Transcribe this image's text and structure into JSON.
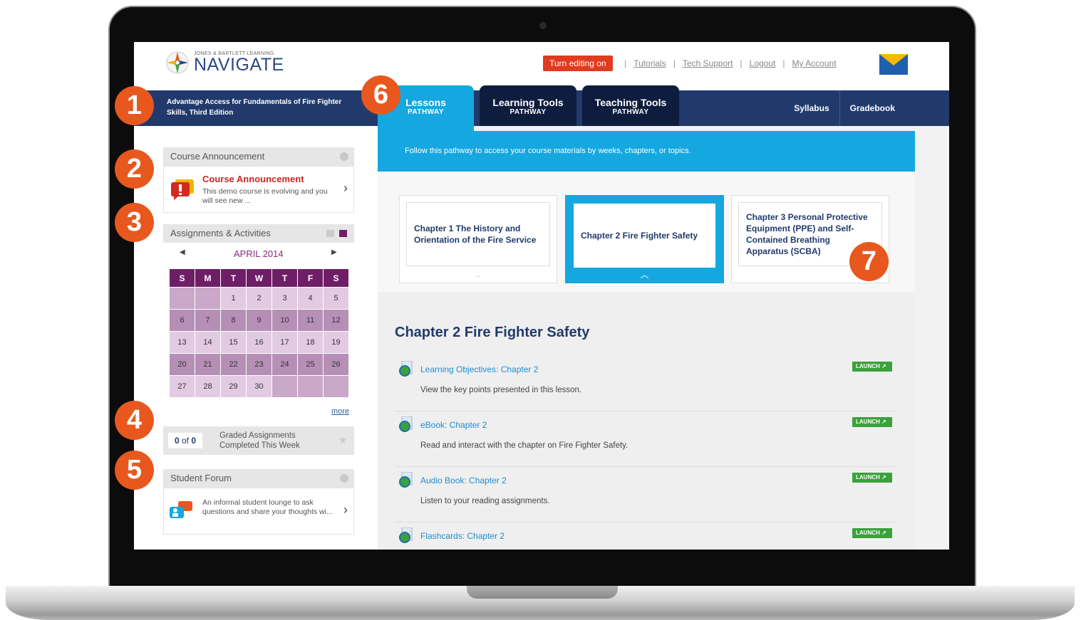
{
  "header": {
    "logo_small": "JONES & BARTLETT LEARNING",
    "logo_big": "NAVIGATE",
    "edit_button": "Turn editing on",
    "links": [
      "Tutorials",
      "Tech Support",
      "Logout",
      "My Account"
    ]
  },
  "nav": {
    "course_title": "Advantage Access for Fundamentals of Fire Fighter Skills, Third Edition",
    "tabs": [
      {
        "label": "Lessons",
        "sub": "PATHWAY"
      },
      {
        "label": "Learning Tools",
        "sub": "PATHWAY"
      },
      {
        "label": "Teaching Tools",
        "sub": "PATHWAY"
      }
    ],
    "right_links": [
      "Syllabus",
      "Gradebook"
    ]
  },
  "sidebar": {
    "announcement": {
      "header": "Course Announcement",
      "title": "Course Announcement",
      "text": "This demo course is evolving and you will see new ..."
    },
    "assignments": {
      "header": "Assignments & Activities",
      "month": "APRIL 2014",
      "weekdays": [
        "S",
        "M",
        "T",
        "W",
        "T",
        "F",
        "S"
      ],
      "weeks": [
        [
          "",
          "",
          "1",
          "2",
          "3",
          "4",
          "5"
        ],
        [
          "6",
          "7",
          "8",
          "9",
          "10",
          "11",
          "12"
        ],
        [
          "13",
          "14",
          "15",
          "16",
          "17",
          "18",
          "19"
        ],
        [
          "20",
          "21",
          "22",
          "23",
          "24",
          "25",
          "26"
        ],
        [
          "27",
          "28",
          "29",
          "30",
          "",
          "",
          ""
        ]
      ],
      "today": "8",
      "more": "more"
    },
    "graded": {
      "count_done": "0",
      "of": "of",
      "count_total": "0",
      "line1": "Graded Assignments",
      "line2": "Completed This Week"
    },
    "forum": {
      "header": "Student Forum",
      "text": "An informal student lounge to ask questions and share your thoughts wi..."
    }
  },
  "main": {
    "banner": "Follow this pathway to access your course materials by weeks, chapters, or topics.",
    "chapters": [
      "Chapter 1 The History and Orientation of the Fire Service",
      "Chapter 2 Fire Fighter Safety",
      "Chapter 3 Personal Protective Equipment (PPE) and Self-Contained Breathing Apparatus (SCBA)"
    ],
    "active_chapter_index": 1,
    "heading": "Chapter 2 Fire Fighter Safety",
    "launch_label": "LAUNCH",
    "resources": [
      {
        "title": "Learning Objectives: Chapter 2",
        "desc": "View the key points presented in this lesson."
      },
      {
        "title": "eBook: Chapter 2",
        "desc": "Read and interact with the chapter on Fire Fighter Safety."
      },
      {
        "title": "Audio Book: Chapter 2",
        "desc": "Listen to your reading assignments."
      },
      {
        "title": "Flashcards: Chapter 2",
        "desc": ""
      }
    ]
  },
  "callouts": [
    "1",
    "2",
    "3",
    "4",
    "5",
    "6",
    "7"
  ],
  "colors": {
    "navy": "#213a6b",
    "sky": "#15a7e0",
    "orange": "#e8581e",
    "purple": "#6e1e66"
  }
}
